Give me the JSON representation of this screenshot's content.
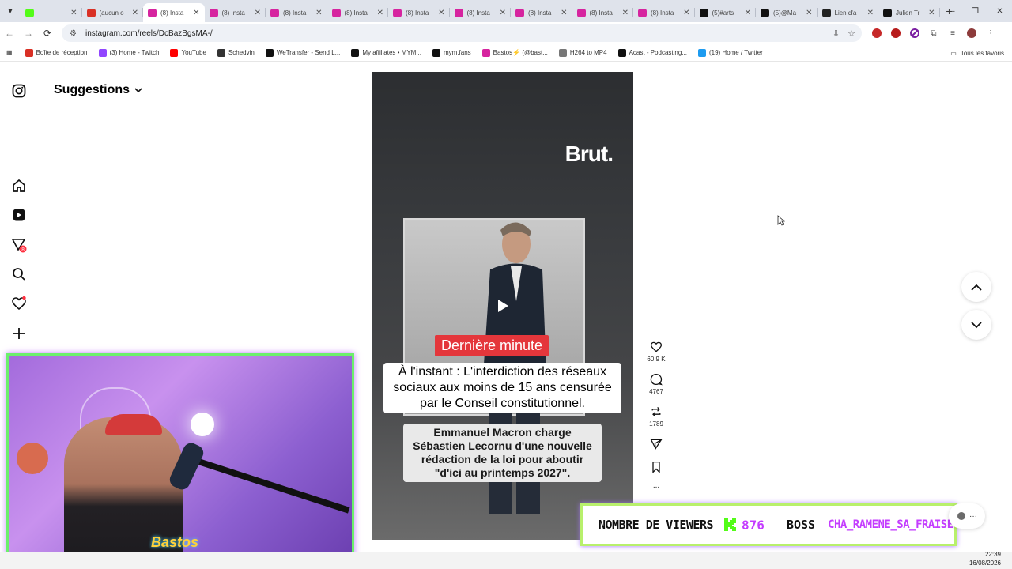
{
  "browser": {
    "tabs": [
      {
        "title": "",
        "favicon_color": "#53fc18",
        "active": false
      },
      {
        "title": "(aucun o",
        "favicon_color": "#d93025",
        "active": false
      },
      {
        "title": "(8) Insta",
        "favicon_color": "#d6249f",
        "active": true
      },
      {
        "title": "(8) Insta",
        "favicon_color": "#d6249f",
        "active": false
      },
      {
        "title": "(8) Insta",
        "favicon_color": "#d6249f",
        "active": false
      },
      {
        "title": "(8) Insta",
        "favicon_color": "#d6249f",
        "active": false
      },
      {
        "title": "(8) Insta",
        "favicon_color": "#d6249f",
        "active": false
      },
      {
        "title": "(8) Insta",
        "favicon_color": "#d6249f",
        "active": false
      },
      {
        "title": "(8) Insta",
        "favicon_color": "#d6249f",
        "active": false
      },
      {
        "title": "(8) Insta",
        "favicon_color": "#d6249f",
        "active": false
      },
      {
        "title": "(8) Insta",
        "favicon_color": "#d6249f",
        "active": false
      },
      {
        "title": "(5)#arts",
        "favicon_color": "#111111",
        "active": false
      },
      {
        "title": "(5)@Ma",
        "favicon_color": "#111111",
        "active": false
      },
      {
        "title": "Lien d'a",
        "favicon_color": "#222222",
        "active": false
      },
      {
        "title": "Julien Tr",
        "favicon_color": "#111111",
        "active": false
      }
    ],
    "url": "instagram.com/reels/DcBazBgsMA-/",
    "bookmarks": [
      {
        "label": "Boîte de réception",
        "color": "#d93025"
      },
      {
        "label": "(3) Home - Twitch",
        "color": "#9146ff"
      },
      {
        "label": "YouTube",
        "color": "#ff0000"
      },
      {
        "label": "Schedvin",
        "color": "#333333"
      },
      {
        "label": "WeTransfer - Send L...",
        "color": "#111111"
      },
      {
        "label": "My affiliates • MYM...",
        "color": "#111111"
      },
      {
        "label": "mym.fans",
        "color": "#111111"
      },
      {
        "label": "Bastos⚡ (@bast...",
        "color": "#d6249f"
      },
      {
        "label": "H264 to MP4",
        "color": "#777777"
      },
      {
        "label": "Acast - Podcasting...",
        "color": "#111111"
      },
      {
        "label": "(19) Home / Twitter",
        "color": "#1d9bf0"
      }
    ],
    "all_bookmarks_label": "Tous les favoris"
  },
  "instagram": {
    "header_title": "Suggestions",
    "sidebar_badge": "8",
    "reel": {
      "watermark": "Brut.",
      "breaking_label": "Dernière minute",
      "headline": "À l'instant : L'interdiction des réseaux sociaux aux moins de 15 ans censurée par le Conseil constitutionnel.",
      "subline": "Emmanuel Macron charge Sébastien Lecornu d'une nouvelle rédaction de la loi pour aboutir \"d'ici au printemps 2027\"."
    },
    "actions": {
      "likes": "60,9 K",
      "comments": "4767",
      "reposts": "1789",
      "more": "..."
    }
  },
  "stream_overlay": {
    "viewers_label": "NOMBRE DE VIEWERS",
    "viewers_count": "876",
    "boss_label": "BOSS",
    "boss_name": "CHA_RAMENE_SA_FRAISE",
    "cam_logo": "Bastos",
    "accent_green": "#53fc18",
    "accent_purple": "#c43cff"
  },
  "system": {
    "time": "22:39",
    "date": "16/08/2026"
  }
}
